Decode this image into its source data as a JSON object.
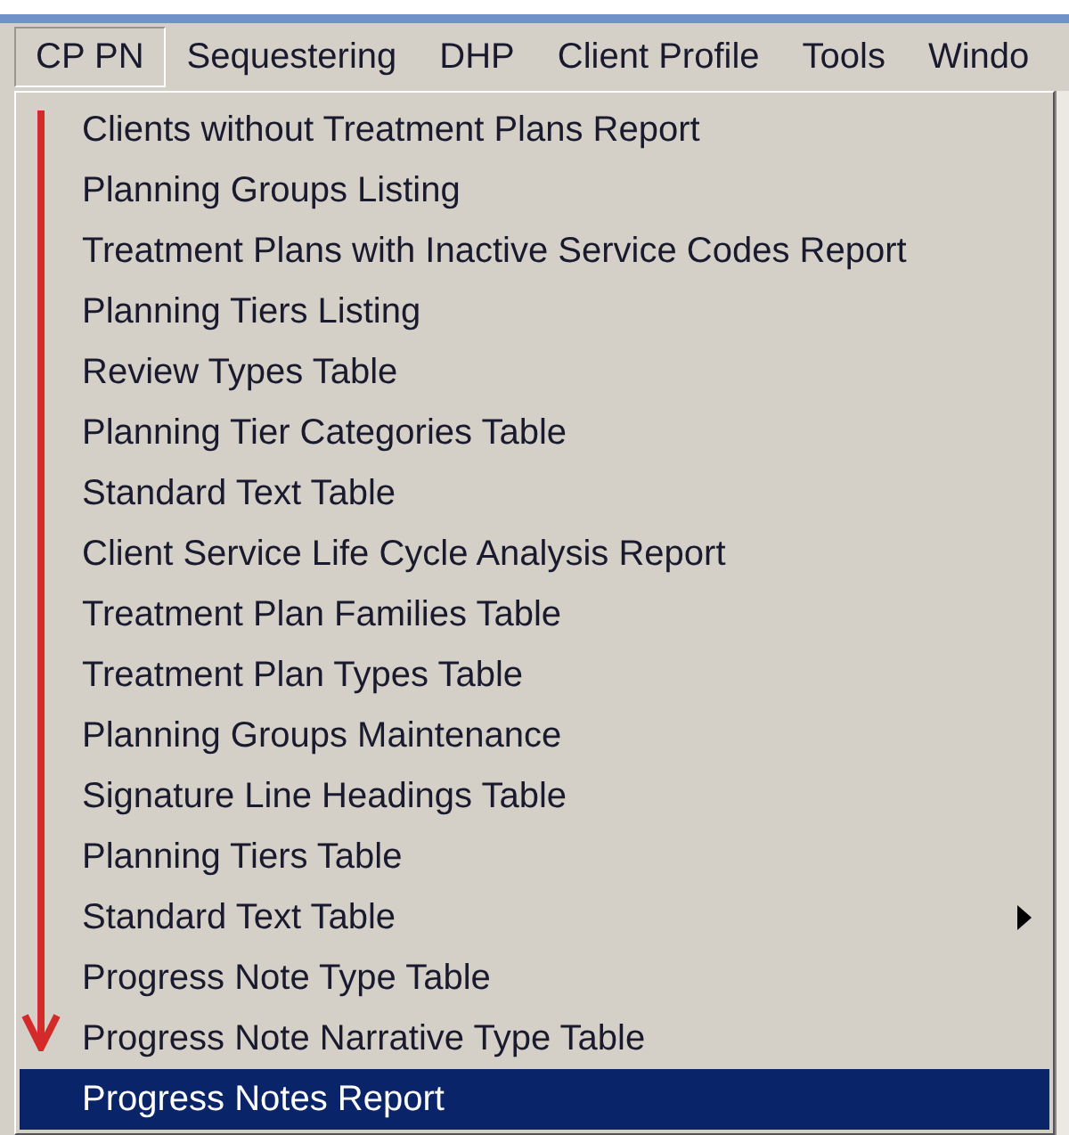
{
  "menubar": [
    {
      "label": "CP PN",
      "selected": true
    },
    {
      "label": "Sequestering",
      "selected": false
    },
    {
      "label": "DHP",
      "selected": false
    },
    {
      "label": "Client Profile",
      "selected": false
    },
    {
      "label": "Tools",
      "selected": false
    },
    {
      "label": "Windo",
      "selected": false
    }
  ],
  "menu": {
    "items": [
      {
        "label": "Clients without Treatment Plans Report",
        "submenu": false,
        "selected": false
      },
      {
        "label": "Planning Groups Listing",
        "submenu": false,
        "selected": false
      },
      {
        "label": "Treatment Plans with Inactive Service Codes Report",
        "submenu": false,
        "selected": false
      },
      {
        "label": "Planning Tiers Listing",
        "submenu": false,
        "selected": false
      },
      {
        "label": "Review Types Table",
        "submenu": false,
        "selected": false
      },
      {
        "label": "Planning Tier Categories Table",
        "submenu": false,
        "selected": false
      },
      {
        "label": "Standard Text Table",
        "submenu": false,
        "selected": false
      },
      {
        "label": "Client Service Life Cycle Analysis Report",
        "submenu": false,
        "selected": false
      },
      {
        "label": "Treatment Plan Families Table",
        "submenu": false,
        "selected": false
      },
      {
        "label": "Treatment Plan Types Table",
        "submenu": false,
        "selected": false
      },
      {
        "label": "Planning Groups Maintenance",
        "submenu": false,
        "selected": false
      },
      {
        "label": "Signature Line Headings Table",
        "submenu": false,
        "selected": false
      },
      {
        "label": "Planning Tiers Table",
        "submenu": false,
        "selected": false
      },
      {
        "label": "Standard Text Table",
        "submenu": true,
        "selected": false
      },
      {
        "label": "Progress Note Type Table",
        "submenu": false,
        "selected": false
      },
      {
        "label": "Progress Note Narrative Type Table",
        "submenu": false,
        "selected": false
      },
      {
        "label": "Progress Notes Report",
        "submenu": false,
        "selected": true
      }
    ]
  }
}
